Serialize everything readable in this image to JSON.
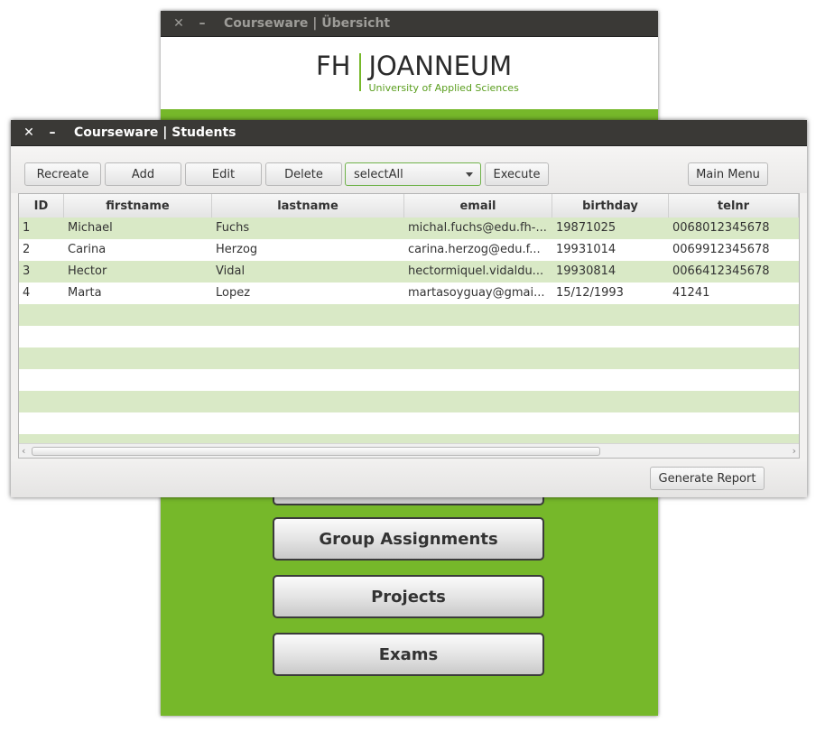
{
  "back_window": {
    "title": "Courseware | Übersicht",
    "logo": {
      "fh": "FH",
      "name": "JOANNEUM",
      "subtitle": "University of Applied Sciences"
    },
    "menu_buttons": [
      "Group Assignments",
      "Projects",
      "Exams"
    ],
    "accent_color": "#76b82a"
  },
  "front_window": {
    "title": "Courseware | Students",
    "toolbar": {
      "recreate": "Recreate",
      "add": "Add",
      "edit": "Edit",
      "delete": "Delete",
      "query_select": "selectAll",
      "execute": "Execute",
      "main_menu": "Main Menu"
    },
    "table": {
      "columns": [
        "ID",
        "firstname",
        "lastname",
        "email",
        "birthday",
        "telnr"
      ],
      "rows": [
        [
          "1",
          "Michael",
          "Fuchs",
          "michal.fuchs@edu.fh-...",
          "19871025",
          "0068012345678"
        ],
        [
          "2",
          "Carina",
          "Herzog",
          "carina.herzog@edu.f...",
          "19931014",
          "0069912345678"
        ],
        [
          "3",
          "Hector",
          "Vidal",
          "hectormiquel.vidaldu...",
          "19930814",
          "0066412345678"
        ],
        [
          "4",
          "Marta",
          "Lopez",
          "martasoyguay@gmai...",
          "15/12/1993",
          "41241"
        ]
      ],
      "row_stripe_color": "#d9e9c6"
    },
    "generate_report": "Generate Report"
  },
  "icons": {
    "close": "close-icon",
    "minimize": "minimize-icon"
  }
}
